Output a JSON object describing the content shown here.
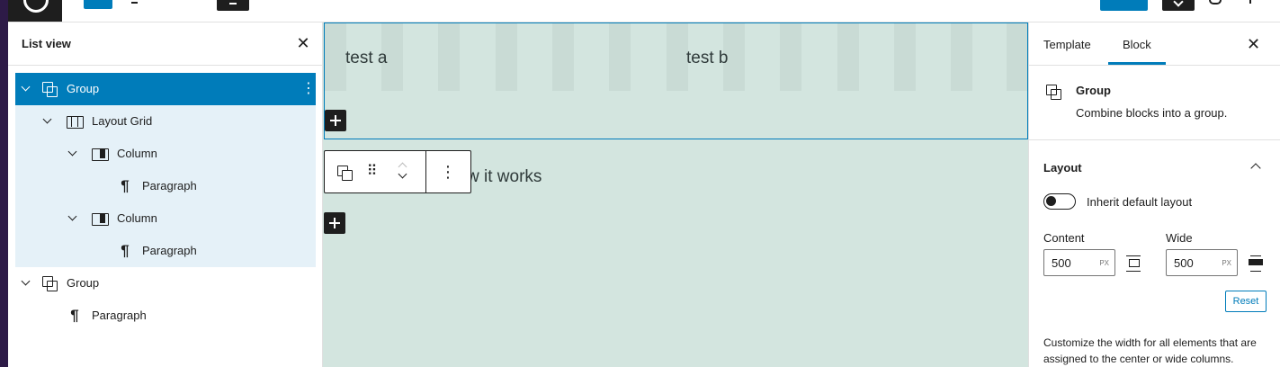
{
  "list_view": {
    "title": "List view",
    "items": [
      {
        "label": "Group",
        "type": "group"
      },
      {
        "label": "Layout Grid",
        "type": "grid"
      },
      {
        "label": "Column",
        "type": "column"
      },
      {
        "label": "Paragraph",
        "type": "paragraph"
      },
      {
        "label": "Column",
        "type": "column"
      },
      {
        "label": "Paragraph",
        "type": "paragraph"
      },
      {
        "label": "Group",
        "type": "group"
      },
      {
        "label": "Paragraph",
        "type": "paragraph"
      }
    ]
  },
  "canvas": {
    "text_a": "test a",
    "text_b": "test b",
    "text_partial": "w it works",
    "background": "#d3e5df"
  },
  "sidebar": {
    "tabs": {
      "template": "Template",
      "block": "Block"
    },
    "block_card": {
      "title": "Group",
      "description": "Combine blocks into a group."
    },
    "layout": {
      "title": "Layout",
      "toggle_label": "Inherit default layout",
      "toggle_on": false,
      "content_label": "Content",
      "content_value": "500",
      "wide_label": "Wide",
      "wide_value": "500",
      "unit": "PX",
      "reset_label": "Reset",
      "help_text": "Customize the width for all elements that are assigned to the center or wide columns."
    }
  },
  "colors": {
    "accent": "#007cba",
    "dark": "#1e1e1e",
    "edge": "#2d1a47",
    "selected_light": "#e5f1f8"
  }
}
